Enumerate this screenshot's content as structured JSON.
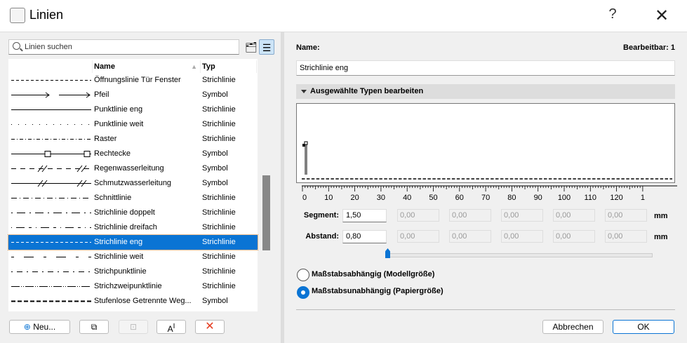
{
  "window": {
    "title": "Linien",
    "help": "?",
    "close": "✕"
  },
  "search": {
    "placeholder": "Linien suchen"
  },
  "list": {
    "columns": {
      "name": "Name",
      "type": "Typ"
    },
    "rows": [
      {
        "name": "Öffnungslinie Tür Fenster",
        "type": "Strichlinie",
        "pattern": "dash-fine"
      },
      {
        "name": "Pfeil",
        "type": "Symbol",
        "pattern": "arrow"
      },
      {
        "name": "Punktlinie eng",
        "type": "Strichlinie",
        "pattern": "solid"
      },
      {
        "name": "Punktlinie weit",
        "type": "Strichlinie",
        "pattern": "dots"
      },
      {
        "name": "Raster",
        "type": "Strichlinie",
        "pattern": "dashdot-fine"
      },
      {
        "name": "Rechtecke",
        "type": "Symbol",
        "pattern": "rect"
      },
      {
        "name": "Regenwasserleitung",
        "type": "Symbol",
        "pattern": "rain"
      },
      {
        "name": "Schmutzwasserleitung",
        "type": "Symbol",
        "pattern": "sewer"
      },
      {
        "name": "Schnittlinie",
        "type": "Strichlinie",
        "pattern": "dashdot"
      },
      {
        "name": "Strichlinie doppelt",
        "type": "Strichlinie",
        "pattern": "double"
      },
      {
        "name": "Strichlinie dreifach",
        "type": "Strichlinie",
        "pattern": "triple"
      },
      {
        "name": "Strichlinie eng",
        "type": "Strichlinie",
        "pattern": "dash-fine",
        "selected": true
      },
      {
        "name": "Strichlinie weit",
        "type": "Strichlinie",
        "pattern": "dash-wide"
      },
      {
        "name": "Strichpunktlinie",
        "type": "Strichlinie",
        "pattern": "dashdot2"
      },
      {
        "name": "Strichzweipunktlinie",
        "type": "Strichlinie",
        "pattern": "dash2dot"
      },
      {
        "name": "Stufenlose Getrennte Weg...",
        "type": "Symbol",
        "pattern": "bold-dash"
      }
    ]
  },
  "buttons": {
    "new": "Neu...",
    "cancel": "Abbrechen",
    "ok": "OK"
  },
  "detail": {
    "name_label": "Name:",
    "editable": "Bearbeitbar: 1",
    "name_value": "Strichlinie eng",
    "section": "Ausgewählte Typen bearbeiten",
    "ruler": [
      "0",
      "10",
      "20",
      "30",
      "40",
      "50",
      "60",
      "70",
      "80",
      "90",
      "100",
      "110",
      "120",
      "1"
    ],
    "segment_label": "Segment:",
    "segment": [
      "1,50",
      "0,00",
      "0,00",
      "0,00",
      "0,00",
      "0,00"
    ],
    "gap_label": "Abstand:",
    "gap": [
      "0,80",
      "0,00",
      "0,00",
      "0,00",
      "0,00",
      "0,00"
    ],
    "unit": "mm",
    "slider_value": 0,
    "radio_model": "Maßstabsabhängig (Modellgröße)",
    "radio_paper": "Maßstabsunabhängig (Papiergröße)"
  },
  "colors": {
    "accent": "#0a74d4",
    "delete": "#e53b1f"
  }
}
